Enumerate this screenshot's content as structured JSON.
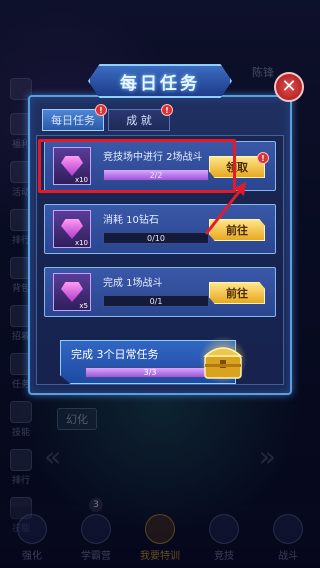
{
  "background": {
    "top_right_name": "陈锋",
    "side_menu": [
      "",
      "福利",
      "活动",
      "排行",
      "背包",
      "招募",
      "任务",
      "技能",
      "排行",
      "技能"
    ],
    "transform_label": "幻化"
  },
  "bottom_nav": {
    "items": [
      {
        "label": "强化",
        "active": false
      },
      {
        "label": "学霸营",
        "active": false,
        "badge": "3"
      },
      {
        "label": "我要特训",
        "active": true
      },
      {
        "label": "竞技",
        "active": false
      },
      {
        "label": "战斗",
        "active": false
      }
    ]
  },
  "dialog": {
    "title": "每日任务",
    "close_icon": "close-icon",
    "tabs": [
      {
        "label": "每日任务",
        "active": true,
        "badge": "!"
      },
      {
        "label": "成 就",
        "active": false,
        "badge": "!"
      }
    ],
    "tasks": [
      {
        "name": "竞技场中进行 2场战斗",
        "progress_text": "2/2",
        "progress": 1.0,
        "reward_qty": "x10",
        "button": "领取",
        "badge": "!"
      },
      {
        "name": "消耗 10钻石",
        "progress_text": "0/10",
        "progress": 0.0,
        "reward_qty": "x10",
        "button": "前往"
      },
      {
        "name": "完成 1场战斗",
        "progress_text": "0/1",
        "progress": 0.0,
        "reward_qty": "x5",
        "button": "前往"
      }
    ],
    "summary": {
      "text": "完成 3个日常任务",
      "progress_text": "3/3",
      "progress": 1.0
    }
  },
  "colors": {
    "highlight": "#e21b2b",
    "accent": "#8fd0ff",
    "button": "#f2c03a"
  }
}
